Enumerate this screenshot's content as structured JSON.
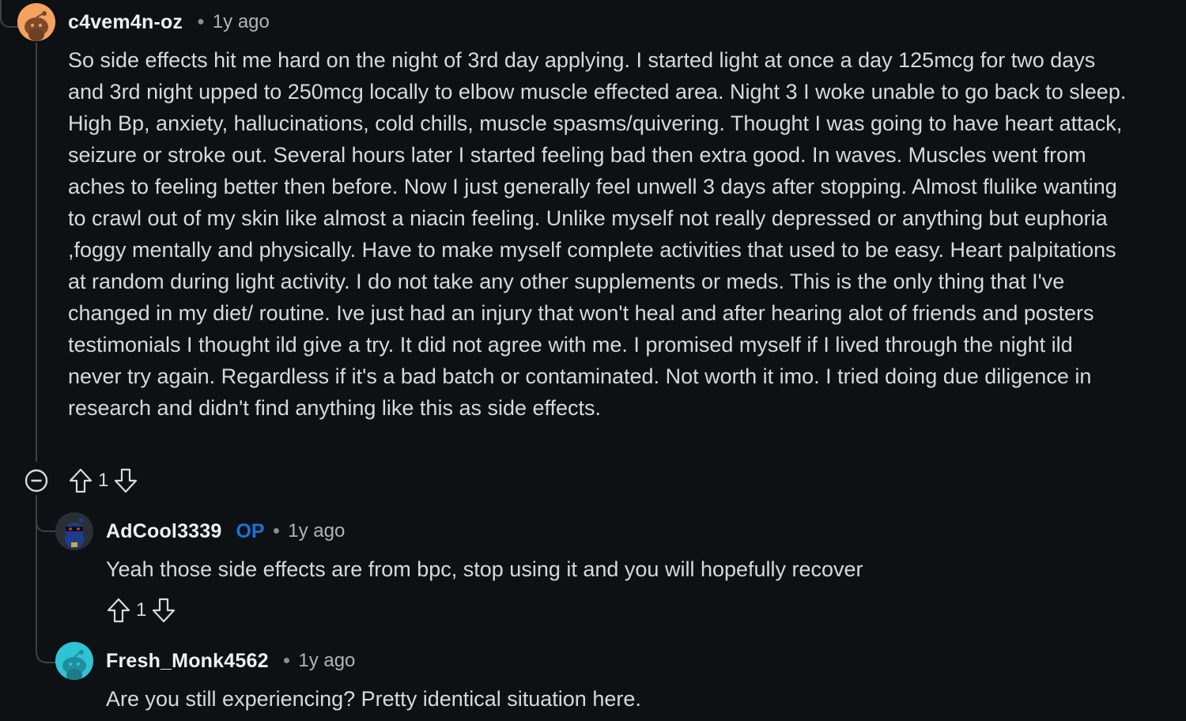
{
  "comments": [
    {
      "username": "c4vem4n-oz",
      "age": "1y ago",
      "body": "So side effects hit me hard on the night of 3rd day applying. I started light at once a day 125mcg for two days and 3rd night upped to 250mcg locally to elbow muscle effected area. Night 3 I woke unable to go back to sleep. High Bp, anxiety, hallucinations, cold chills, muscle spasms/quivering. Thought I was going to have heart attack, seizure or stroke out. Several hours later I started feeling bad then extra good. In waves. Muscles went from aches to feeling better then before. Now I just generally feel unwell 3 days after stopping. Almost flulike wanting to crawl out of my skin like almost a niacin feeling. Unlike myself not really depressed or anything but euphoria ,foggy mentally and physically. Have to make myself complete activities that used to be easy. Heart palpitations at random during light activity. I do not take any other supplements or meds. This is the only thing that I've changed in my diet/ routine. Ive just had an injury that won't heal and after hearing alot of friends and posters testimonials I thought ild give a try. It did not agree with me. I promised myself if I lived through the night ild never try again. Regardless if it's a bad batch or contaminated. Not worth it imo. I tried doing due diligence in research and didn't find anything like this as side effects.",
      "votes": "1",
      "avatar_color": "#f4a25f",
      "icons": [
        "avatar-snoo-icon",
        "collapse-icon",
        "upvote-icon",
        "downvote-icon"
      ]
    },
    {
      "username": "AdCool3339",
      "badge": "OP",
      "age": "1y ago",
      "body": "Yeah those side effects are from bpc, stop using it and you will hopefully recover",
      "votes": "1",
      "avatar_color": "#1a2f5c"
    },
    {
      "username": "Fresh_Monk4562",
      "age": "1y ago",
      "body": "Are you still experiencing? Pretty identical situation here.",
      "avatar_color": "#2ec4d6"
    }
  ],
  "colors": {
    "background": "#0e1113",
    "text": "#d7dadc",
    "op_badge": "#1f6fe0",
    "thread_line": "#3e4142"
  }
}
